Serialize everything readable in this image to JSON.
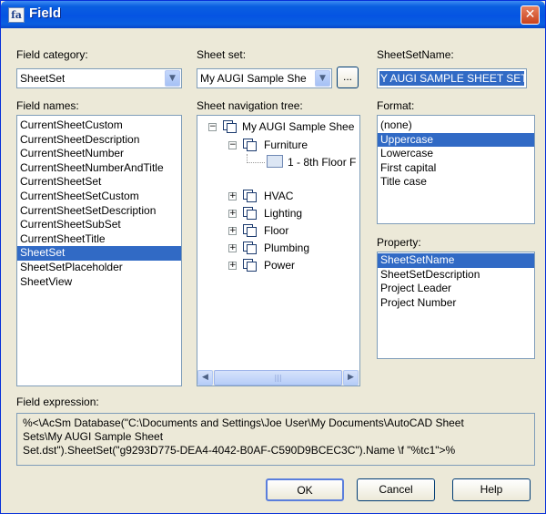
{
  "window": {
    "title": "Field",
    "icon_name": "field-app-icon",
    "close_label": "✕"
  },
  "field_category": {
    "label": "Field category:",
    "value": "SheetSet"
  },
  "field_names": {
    "label": "Field names:",
    "items": [
      "CurrentSheetCustom",
      "CurrentSheetDescription",
      "CurrentSheetNumber",
      "CurrentSheetNumberAndTitle",
      "CurrentSheetSet",
      "CurrentSheetSetCustom",
      "CurrentSheetSetDescription",
      "CurrentSheetSubSet",
      "CurrentSheetTitle",
      "SheetSet",
      "SheetSetPlaceholder",
      "SheetView"
    ],
    "selected": "SheetSet"
  },
  "sheet_set": {
    "label": "Sheet set:",
    "value": "My AUGI Sample She",
    "browse_label": "..."
  },
  "sheet_nav_tree": {
    "label": "Sheet navigation tree:",
    "root": "My AUGI Sample Shee",
    "nodes": [
      {
        "label": "Furniture",
        "expanded": true
      },
      {
        "label": "1 - 8th Floor F",
        "child": true
      },
      {
        "label": "HVAC"
      },
      {
        "label": "Lighting"
      },
      {
        "label": "Floor"
      },
      {
        "label": "Plumbing"
      },
      {
        "label": "Power"
      }
    ]
  },
  "sheet_set_name": {
    "label": "SheetSetName:",
    "value": "Y AUGI SAMPLE SHEET SET"
  },
  "format": {
    "label": "Format:",
    "items": [
      "(none)",
      "Uppercase",
      "Lowercase",
      "First capital",
      "Title case"
    ],
    "selected": "Uppercase"
  },
  "property": {
    "label": "Property:",
    "items": [
      "SheetSetName",
      "SheetSetDescription",
      "Project Leader",
      "Project Number"
    ],
    "selected": "SheetSetName"
  },
  "field_expression": {
    "label": "Field expression:",
    "line1": "%<\\AcSm Database(\"C:\\Documents and Settings\\Joe User\\My Documents\\AutoCAD Sheet",
    "line2": "Sets\\My AUGI Sample Sheet",
    "line3": "Set.dst\").SheetSet(\"g9293D775-DEA4-4042-B0AF-C590D9BCEC3C\").Name \\f \"%tc1\">%"
  },
  "buttons": {
    "ok": "OK",
    "cancel": "Cancel",
    "help": "Help"
  },
  "colors": {
    "titlebar": "#0554e3",
    "selection": "#316ac5",
    "dialog_bg": "#ece9d8"
  }
}
